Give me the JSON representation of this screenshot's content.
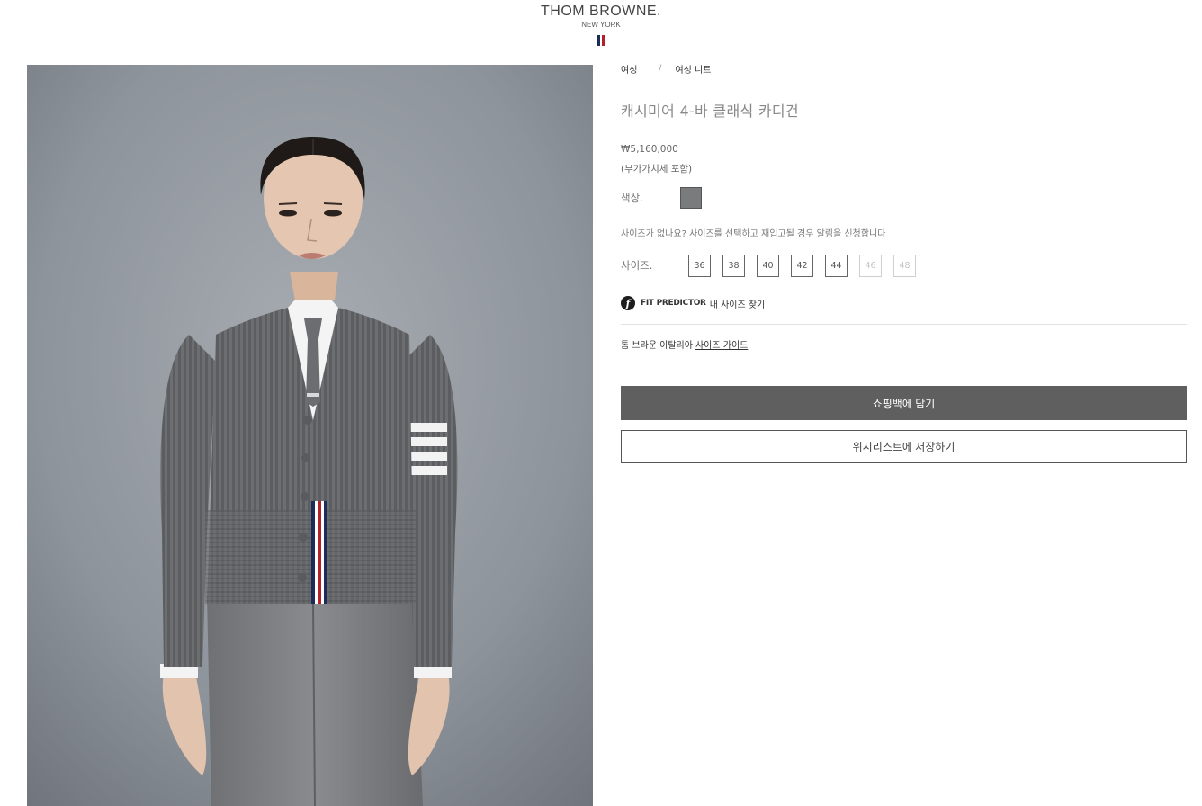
{
  "colors": {
    "red": "#b51f29",
    "navy": "#1c2b5a",
    "primary_button": "#5f5f5f",
    "swatch": "#7a7b7d",
    "photo_background": "#8c9299"
  },
  "header": {
    "brand": "THOM BROWNE.",
    "city": "NEW YORK"
  },
  "breadcrumb": {
    "items": [
      "여성",
      "여성 니트"
    ],
    "separator": "/"
  },
  "product": {
    "title": "캐시미어 4-바 클래식 카디건",
    "price": "₩5,160,000",
    "vat_note": "(부가가치세 포함)",
    "image_icon": "product-photo-cardigan"
  },
  "color": {
    "label": "색상.",
    "selected_swatch": "#7a7b7d"
  },
  "notify_text": "사이즈가 없나요? 사이즈를 선택하고 재입고될 경우 알림을 신청합니다",
  "size": {
    "label": "사이즈.",
    "options": [
      {
        "value": "36",
        "available": true
      },
      {
        "value": "38",
        "available": true
      },
      {
        "value": "40",
        "available": true
      },
      {
        "value": "42",
        "available": true
      },
      {
        "value": "44",
        "available": true
      },
      {
        "value": "46",
        "available": false
      },
      {
        "value": "48",
        "available": false
      }
    ]
  },
  "fit_predictor": {
    "icon": "f",
    "label": "FIT PREDICTOR",
    "link": "내 사이즈 찾기"
  },
  "size_guide": {
    "prefix": "톰 브라운 이탈리아",
    "link": "사이즈 가이드"
  },
  "actions": {
    "add_to_bag": "쇼핑백에 담기",
    "save_wishlist": "위시리스트에 저장하기"
  }
}
